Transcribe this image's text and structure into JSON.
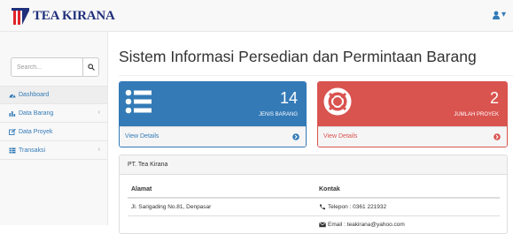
{
  "brand": {
    "logo_text": "TEA KIRANA",
    "logo_icon": "tea-kirana-logo"
  },
  "navbar": {
    "user_icon": "user-icon",
    "user_caret": "▾"
  },
  "sidebar": {
    "search": {
      "placeholder": "Search...",
      "icon": "search-icon"
    },
    "items": [
      {
        "label": "Dashboard",
        "icon": "dashboard-icon",
        "has_arrow": false
      },
      {
        "label": "Data Barang",
        "icon": "bar-chart-icon",
        "has_arrow": true,
        "arrow": "‹"
      },
      {
        "label": "Data Proyek",
        "icon": "edit-icon",
        "has_arrow": false
      },
      {
        "label": "Transaksi",
        "icon": "table-icon",
        "has_arrow": true,
        "arrow": "‹"
      }
    ]
  },
  "main": {
    "title": "Sistem Informasi Persedian dan Permintaan Barang",
    "cards": [
      {
        "value": "14",
        "label": "JENIS BARANG",
        "link": "View Details",
        "icon": "list-icon",
        "color": "#337ab7"
      },
      {
        "value": "2",
        "label": "JUMLAH PROYEK",
        "link": "View Details",
        "icon": "life-ring-icon",
        "color": "#d9534f"
      }
    ],
    "info": {
      "heading": "PT. Tea Kirana",
      "columns": [
        "Alamat",
        "Kontak"
      ],
      "rows": [
        {
          "alamat": "Jl. Sarigading No.81, Denpasar",
          "kontak": "Telepon : 0361 221932",
          "kontak_icon": "phone-icon"
        },
        {
          "alamat": "",
          "kontak": "Email : teakirana@yahoo.com",
          "kontak_icon": "envelope-icon"
        }
      ]
    }
  }
}
